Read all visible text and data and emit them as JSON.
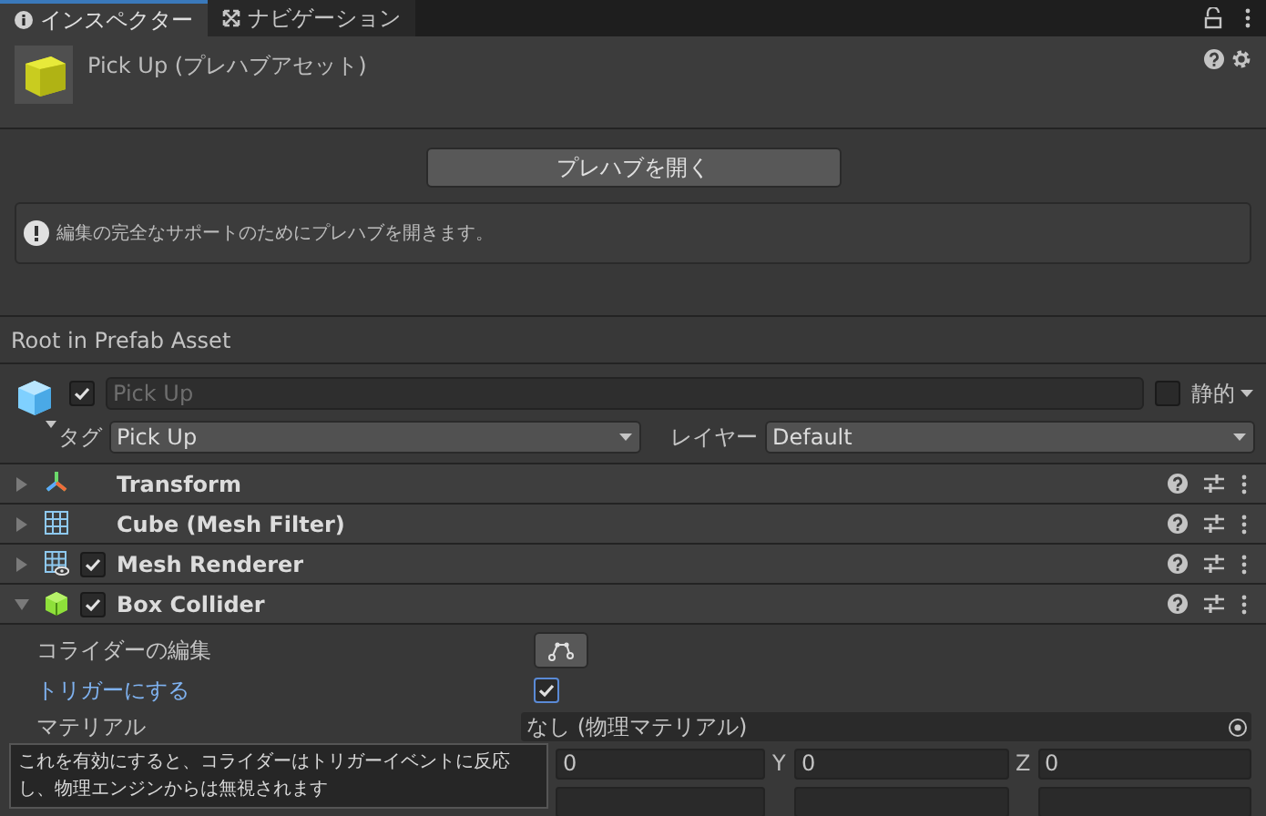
{
  "tabs": [
    {
      "label": "インスペクター",
      "kind": "info",
      "selected": true
    },
    {
      "label": "ナビゲーション",
      "kind": "nav",
      "selected": false
    }
  ],
  "header": {
    "title": "Pick Up (プレハブアセット)"
  },
  "open_prefab_button": "プレハブを開く",
  "help_box": "編集の完全なサポートのためにプレハブを開きます。",
  "section_title": "Root in Prefab Asset",
  "game_object": {
    "active": true,
    "name": "Pick Up",
    "static_label": "静的",
    "static": false,
    "tag_label": "タグ",
    "tag": "Pick Up",
    "layer_label": "レイヤー",
    "layer": "Default"
  },
  "components": [
    {
      "name": "Transform",
      "kind": "transform",
      "expanded": false
    },
    {
      "name": "Cube (Mesh Filter)",
      "kind": "mesh-filter",
      "expanded": false
    },
    {
      "name": "Mesh Renderer",
      "kind": "mesh-renderer",
      "expanded": false,
      "enabled": true
    },
    {
      "name": "Box Collider",
      "kind": "box-collider",
      "expanded": true,
      "enabled": true
    }
  ],
  "box_collider": {
    "edit_label": "コライダーの編集",
    "trigger_label": "トリガーにする",
    "is_trigger": true,
    "material_label": "マテリアル",
    "material": "なし (物理マテリアル)",
    "center": [
      {
        "axis": "Y",
        "value": "0"
      },
      {
        "axis": "Z",
        "value": "0"
      }
    ],
    "center_x_value": "0"
  },
  "tooltip": "これを有効にすると、コライダーはトリガーイベントに反応し、物理エンジンからは無視されます"
}
